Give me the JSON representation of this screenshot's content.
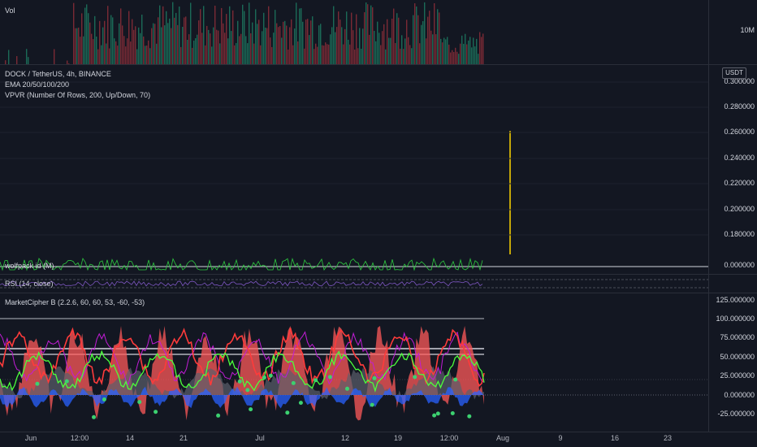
{
  "volume": {
    "label": "Vol",
    "tick": "10M"
  },
  "main_pane": {
    "symbol": "DOCK / TetherUS, 4h, BINANCE",
    "indicators": [
      "EMA 20/50/100/200",
      "VPVR (Number Of Rows, 200, Up/Down, 70)"
    ],
    "currency": "USDT",
    "price_ticks": [
      "0.300000",
      "0.280000",
      "0.260000",
      "0.240000",
      "0.220000",
      "0.200000",
      "0.180000",
      "0.000000"
    ]
  },
  "wolfpack": {
    "label": "wolfpack id (M)"
  },
  "rsi": {
    "label": "RSI (14, close)"
  },
  "market_cipher": {
    "label": "MarketCipher B (2.2.6, 60, 60, 53, -60, -53)",
    "ticks": [
      "125.000000",
      "100.000000",
      "75.000000",
      "50.000000",
      "25.000000",
      "0.000000",
      "-25.000000"
    ]
  },
  "time_axis": [
    "Jun",
    "12:00",
    "14",
    "21",
    "Jul",
    "12",
    "19",
    "12:00",
    "Aug",
    "9",
    "16",
    "23"
  ],
  "colors": {
    "background": "#131722",
    "price_candle": "#ffd600",
    "wave_red": "#ff3b3b",
    "wave_green": "#4cff3b",
    "wave_purple": "#c21cd6",
    "money_flow_blue": "#2962ff",
    "dot_green": "#3cd170"
  }
}
